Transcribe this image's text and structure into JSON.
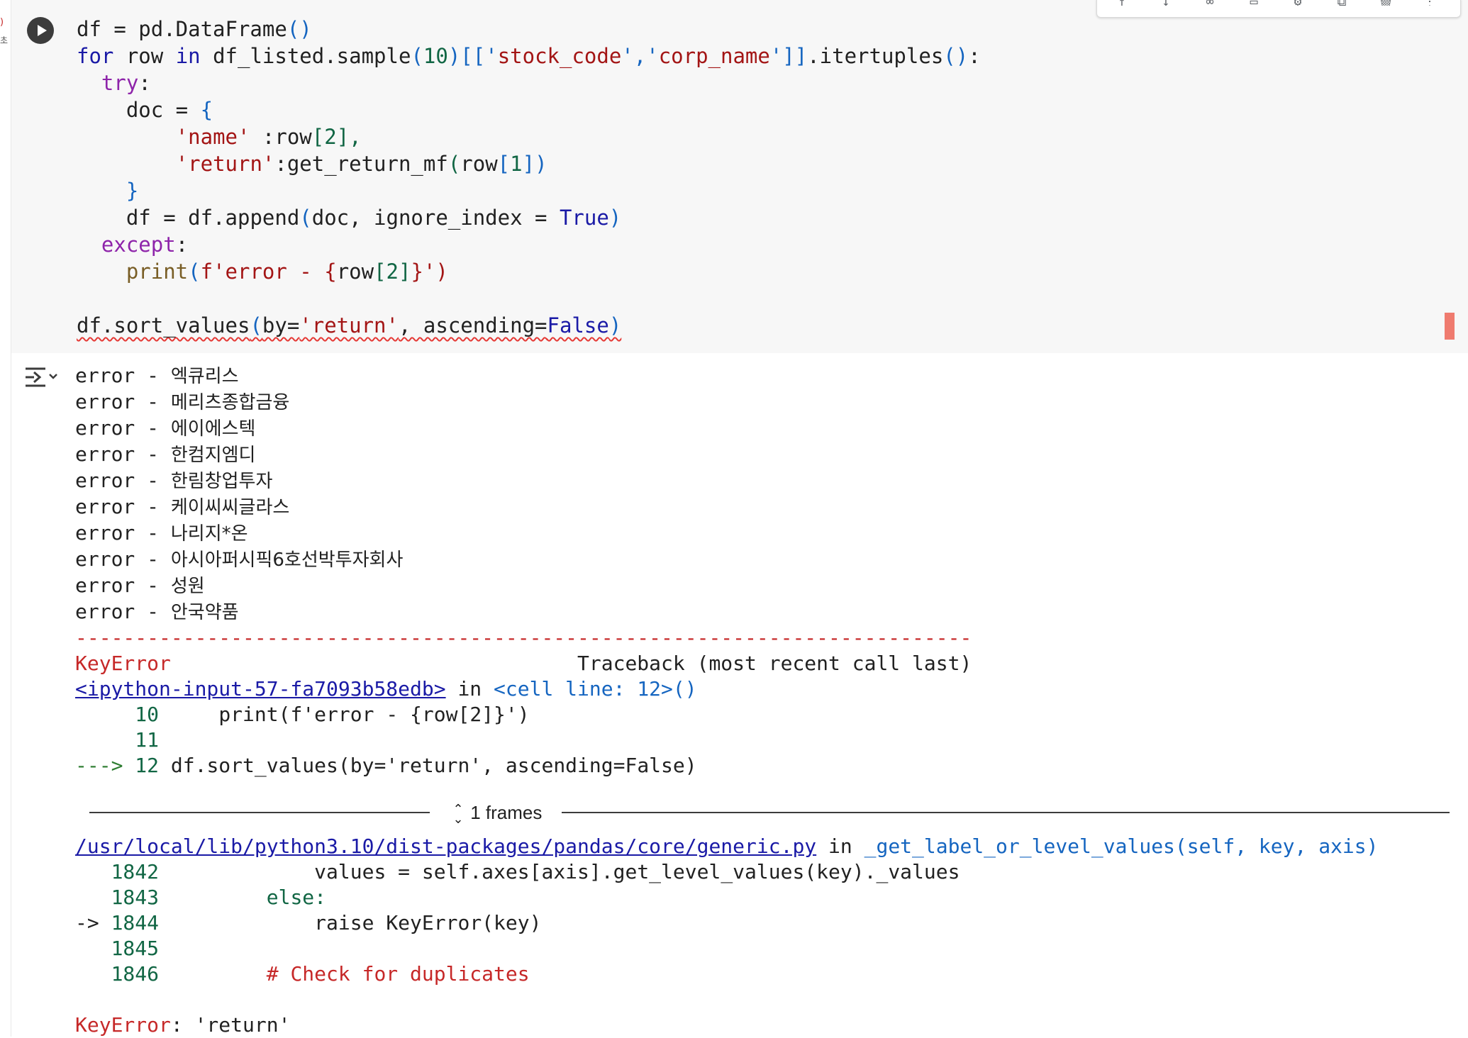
{
  "gutter": {
    "mark_top": ")",
    "mark_bottom": "초"
  },
  "code_lines": [
    [
      "df = pd.DataFrame",
      "()"
    ],
    [
      "for",
      " row ",
      "in",
      " df_listed.sample",
      "(",
      "10",
      ")",
      "[['",
      "stock_code",
      "','",
      "corp_name",
      "']]",
      ".itertuples",
      "()",
      ":"
    ],
    [
      "try",
      ":"
    ],
    [
      "doc = ",
      "{"
    ],
    [
      "'name'",
      " :row",
      "[",
      "2",
      "],"
    ],
    [
      "'return'",
      ":get_return_mf",
      "(",
      "row",
      "[",
      "1",
      "])"
    ],
    [
      "}"
    ],
    [
      "df = df.append",
      "(",
      "doc, ignore_index = ",
      "True",
      ")"
    ],
    [
      "except",
      ":"
    ],
    [
      "print",
      "(",
      "f'error - {",
      "row",
      "[",
      "2",
      "]",
      "}')"
    ],
    [
      "df.sort_values",
      "(",
      "by=",
      "'return'",
      ", ascending=",
      "False",
      ")"
    ]
  ],
  "output": {
    "lines": [
      {
        "prefix": "error - ",
        "name": "엑큐리스"
      },
      {
        "prefix": "error - ",
        "name": "메리츠종합금융"
      },
      {
        "prefix": "error - ",
        "name": "에이에스텍"
      },
      {
        "prefix": "error - ",
        "name": "한컴지엠디"
      },
      {
        "prefix": "error - ",
        "name": "한림창업투자"
      },
      {
        "prefix": "error - ",
        "name": "케이씨씨글라스"
      },
      {
        "prefix": "error - ",
        "name": "나리지*온"
      },
      {
        "prefix": "error - ",
        "name": "아시아퍼시픽6호선박투자회사"
      },
      {
        "prefix": "error - ",
        "name": "성원"
      },
      {
        "prefix": "error - ",
        "name": "안국약품"
      }
    ],
    "rule": "---------------------------------------------------------------------------",
    "error_type": "KeyError",
    "traceback_header": "Traceback (most recent call last)",
    "input_link": "<ipython-input-57-fa7093b58edb>",
    "in_word": " in ",
    "cell_ref": "<cell line: 12>",
    "cell_ref_parens": "()",
    "tb1": [
      {
        "num": "10",
        "code": "print(f'error - {row[2]}')"
      },
      {
        "num": "11",
        "code": ""
      }
    ],
    "tb1_arrow": "---> ",
    "tb1_arrow_num": "12",
    "tb1_arrow_code": "df.sort_values(by='return', ascending=False)",
    "frames_label": "1 frames",
    "file_link": "/usr/local/lib/python3.10/dist-packages/pandas/core/generic.py",
    "func_name": "_get_label_or_level_values",
    "func_args": "(self, key, axis)",
    "tb2": [
      {
        "num": "1842",
        "code": "values = self.axes[axis].get_level_values(key)._values"
      },
      {
        "num": "1843",
        "code": "else:"
      },
      {
        "num": "1844",
        "code": "raise KeyError(key)"
      },
      {
        "num": "1845",
        "code": ""
      },
      {
        "num": "1846",
        "code": "# Check for duplicates"
      }
    ],
    "tb2_arrow": "-> ",
    "final_error": "KeyError",
    "final_msg": ": 'return'"
  }
}
